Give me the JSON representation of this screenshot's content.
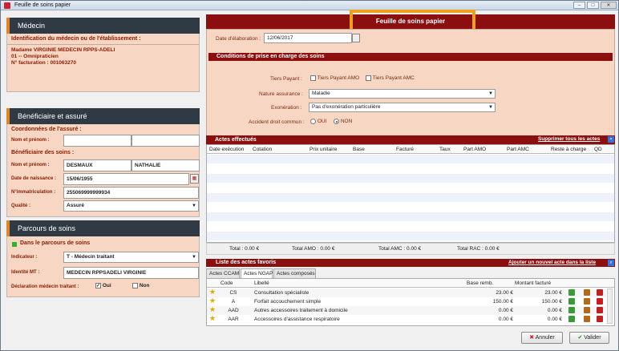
{
  "window": {
    "title": "Feuille de soins papier"
  },
  "medecin": {
    "header": "Médecin",
    "ident_label": "Identification du médecin ou de l'établissement :",
    "name": "Madame VIRGINIE MEDECIN RPPS-ADELI",
    "specialty": "01 -- Omnipraticien",
    "facturation": "N° facturation : 001063270"
  },
  "beneficiaire": {
    "header": "Bénéficiaire et assuré",
    "assure_label": "Coordonnées de l'assuré :",
    "nom_prenom_label": "Nom et prénom :",
    "benef_label": "Bénéficiaire des soins :",
    "nom": "DESMAUX",
    "prenom": "NATHALIE",
    "naissance_label": "Date de naissance :",
    "naissance": "15/06/1955",
    "immat_label": "N°immatriculation :",
    "immat": "255069999999934",
    "qualite_label": "Qualité :",
    "qualite": "Assuré"
  },
  "parcours": {
    "header": "Parcours de soins",
    "status": "Dans le parcours de soins",
    "indicateur_label": "Indicateur :",
    "indicateur": "T - Médecin traitant",
    "identite_label": "Identité MT :",
    "identite": "MEDECIN RPPSADELI VIRGINIE",
    "declaration_label": "Déclaration médecin traitant :",
    "oui": "Oui",
    "non": "Non"
  },
  "form": {
    "title": "Feuille de soins papier",
    "date_label": "Date d'élaboration :",
    "date": "12/06/2017",
    "conditions_title": "Conditions de prise en charge des soins",
    "tiers_label": "Tiers Payant :",
    "tiers_amo": "Tiers Payant AMO",
    "tiers_amc": "Tiers Payant AMC",
    "nature_label": "Nature assurance :",
    "nature": "Maladie",
    "exo_label": "Exonération :",
    "exo": "Pas d'exonération particulière",
    "accident_label": "Accident droit commun :",
    "accident_oui": "OUI",
    "accident_non": "NON"
  },
  "actes": {
    "title": "Actes effectués",
    "delete_all": "Supprimer tous les actes",
    "columns": [
      "Date exécution",
      "Cotation",
      "Prix unitaire",
      "Base",
      "Facturé",
      "Taux",
      "Part AMO",
      "Part AMC",
      "Reste à charge",
      "QD"
    ],
    "totals": {
      "total": "Total : 0.00 €",
      "amo": "Total AMO : 0.00 €",
      "amc": "Total AMC : 0.00 €",
      "rac": "Total RAC : 0.00 €"
    }
  },
  "favoris": {
    "title": "Liste des actes favoris",
    "add_link": "Ajouter un nouvel acte dans la liste",
    "tabs": [
      "Actes CCAM",
      "Actes NGAP",
      "Actes composés"
    ],
    "columns": [
      "Code",
      "Libellé",
      "Base remb.",
      "Montant facturé"
    ],
    "rows": [
      {
        "code": "CS",
        "libelle": "Consultation spécialiste",
        "base": "23.00 €",
        "montant": "23.00 €"
      },
      {
        "code": "A",
        "libelle": "Forfait accouchement simple",
        "base": "150.00 €",
        "montant": "150.00 €"
      },
      {
        "code": "AAD",
        "libelle": "Autres accessoires traitement à domicile",
        "base": "0.00 €",
        "montant": "0.00 €"
      },
      {
        "code": "AAR",
        "libelle": "Accessoires d'assistance respiratoire",
        "base": "0.00 €",
        "montant": "0.00 €"
      }
    ]
  },
  "buttons": {
    "cancel": "Annuler",
    "validate": "Valider"
  },
  "colors": {
    "accent_red": "#8c0f0f",
    "panel_dark": "#2f3a44",
    "highlight_orange": "#f0a020"
  }
}
